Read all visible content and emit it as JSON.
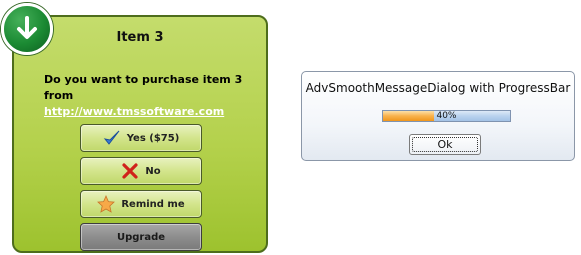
{
  "purchase_dialog": {
    "title": "Item 3",
    "message": "Do you want to purchase item 3 from",
    "link": "http://www.tmssoftware.com",
    "buttons": {
      "yes": "Yes ($75)",
      "no": "No",
      "remind": "Remind me",
      "upgrade": "Upgrade"
    },
    "badge_icon": "download-arrow-icon",
    "colors": {
      "background": "#b4d14c",
      "border": "#4e6d1c",
      "badge": "#1b8a33"
    }
  },
  "progress_dialog": {
    "title": "AdvSmoothMessageDialog with ProgressBar",
    "progress_text": "40%",
    "progress_value": 0.4,
    "ok_label": "Ok",
    "colors": {
      "fill": "#f9b24c",
      "track": "#b9d2ee"
    }
  }
}
